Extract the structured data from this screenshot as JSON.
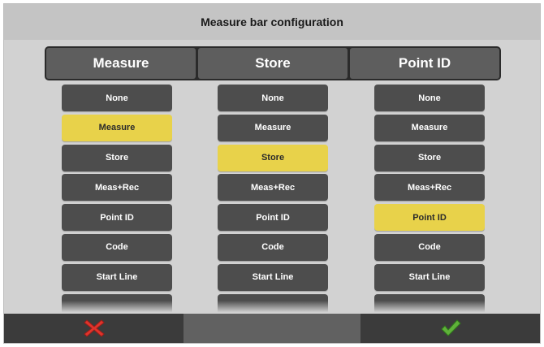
{
  "title": "Measure bar configuration",
  "columns": [
    {
      "header": "Measure",
      "selected": "Measure",
      "options": [
        "None",
        "Measure",
        "Store",
        "Meas+Rec",
        "Point ID",
        "Code",
        "Start Line",
        ""
      ]
    },
    {
      "header": "Store",
      "selected": "Store",
      "options": [
        "None",
        "Measure",
        "Store",
        "Meas+Rec",
        "Point ID",
        "Code",
        "Start Line",
        ""
      ]
    },
    {
      "header": "Point ID",
      "selected": "Point ID",
      "options": [
        "None",
        "Measure",
        "Store",
        "Meas+Rec",
        "Point ID",
        "Code",
        "Start Line",
        ""
      ]
    }
  ],
  "colors": {
    "selected": "#e8d24a",
    "option": "#4d4d4d",
    "header_bg": "#5e5e5e",
    "cancel_icon": "#e0342c",
    "confirm_icon": "#5fb13a"
  },
  "icons": {
    "cancel": "close-x-icon",
    "confirm": "checkmark-icon"
  }
}
